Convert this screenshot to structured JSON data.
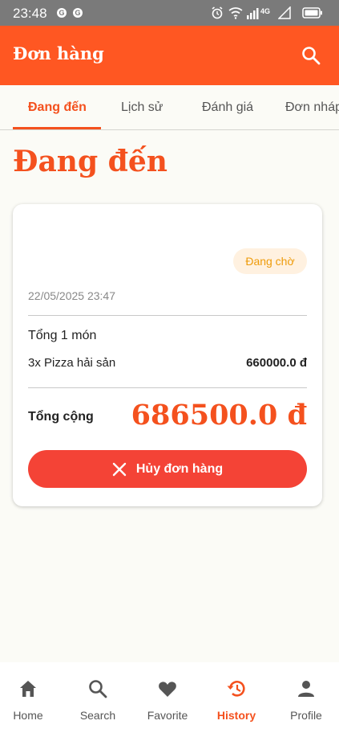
{
  "status_bar": {
    "time": "23:48",
    "app_icon_1": "G",
    "app_icon_2": "G",
    "network_label": "4G",
    "icons": [
      "alarm-icon",
      "wifi-icon",
      "signal-icon",
      "battery-icon"
    ]
  },
  "app_bar": {
    "title": "Đơn hàng",
    "search_icon": "search-icon"
  },
  "tabs": [
    {
      "label": "Đang đến",
      "active": true
    },
    {
      "label": "Lịch sử",
      "active": false
    },
    {
      "label": "Đánh giá",
      "active": false
    },
    {
      "label": "Đơn nháp",
      "active": false
    }
  ],
  "page": {
    "title": "Đang đến"
  },
  "order": {
    "status": "Đang chờ",
    "date": "22/05/2025 23:47",
    "item_count": "Tổng 1 món",
    "items": [
      {
        "name": "3x Pizza hải sản",
        "price": "660000.0 đ"
      }
    ],
    "total_label": "Tổng cộng",
    "total_value": "686500.0 đ",
    "cancel_label": "Hủy đơn hàng"
  },
  "bottom_nav": [
    {
      "label": "Home",
      "icon": "home-icon",
      "active": false
    },
    {
      "label": "Search",
      "icon": "search-icon",
      "active": false
    },
    {
      "label": "Favorite",
      "icon": "heart-icon",
      "active": false
    },
    {
      "label": "History",
      "icon": "history-icon",
      "active": true
    },
    {
      "label": "Profile",
      "icon": "person-icon",
      "active": false
    }
  ],
  "colors": {
    "primary": "#ff5722",
    "accent": "#f4511e",
    "cancel": "#f44336",
    "badge_bg": "#fff1e0",
    "badge_text": "#ee9b0a",
    "background": "#fbfbf6"
  }
}
